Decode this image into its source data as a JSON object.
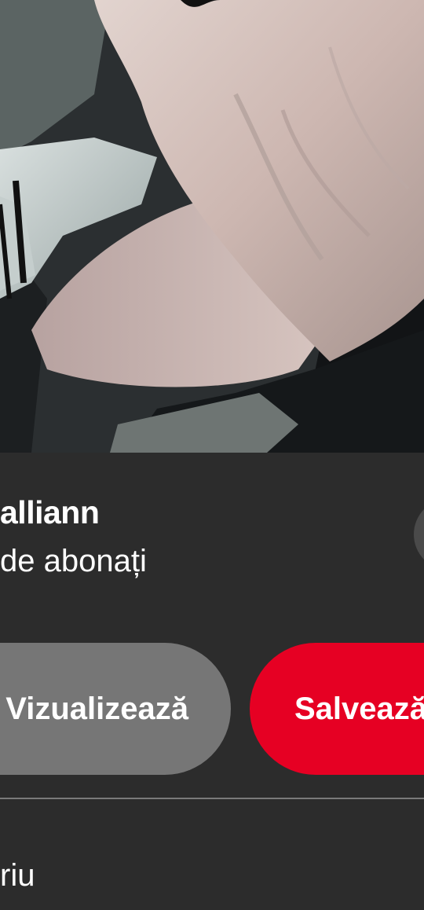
{
  "creator": {
    "name": "alliann",
    "followers_text": "de abonați"
  },
  "actions": {
    "view_label": "Vizualizează",
    "save_label": "Salvează"
  },
  "comments": {
    "label": "riu"
  },
  "colors": {
    "sheet_background": "#2c2c2c",
    "view_button": "#767676",
    "save_button": "#e60023",
    "follow_button": "#4a4a4a",
    "divider": "#7a7a7a",
    "text": "#ffffff"
  },
  "image": {
    "icon": "pin-photo"
  }
}
